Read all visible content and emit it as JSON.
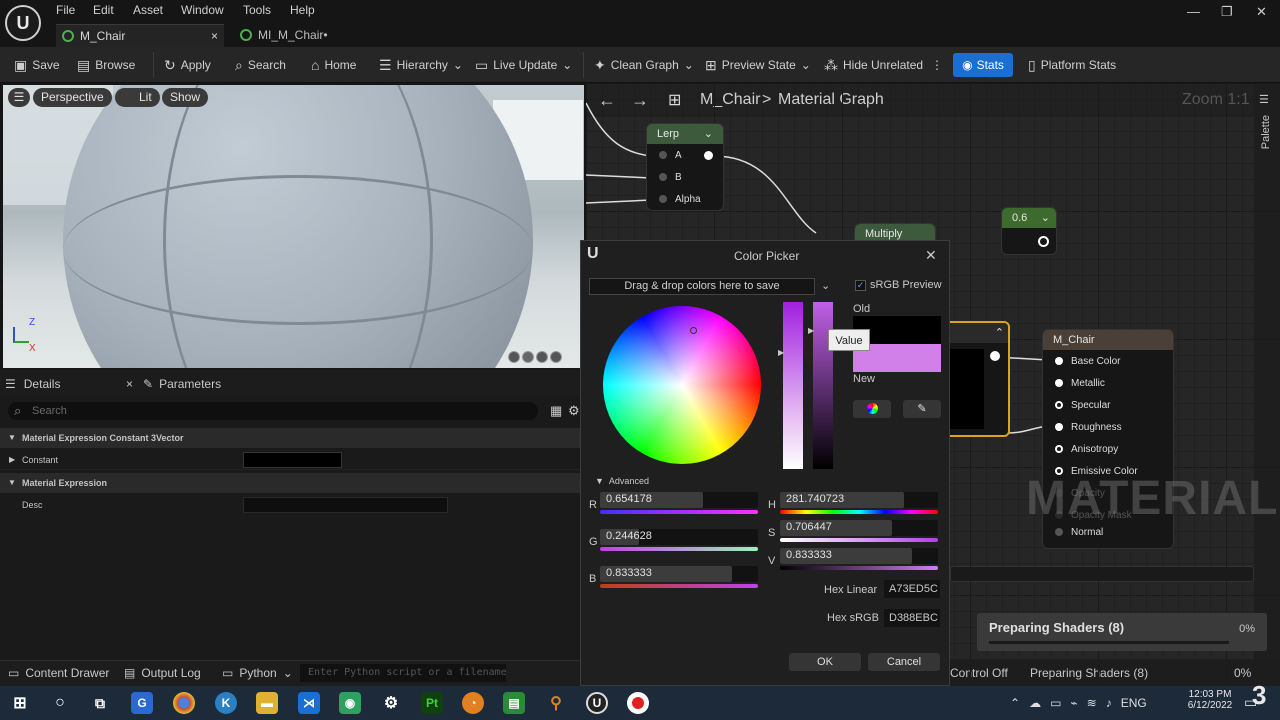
{
  "app": {
    "logo": "U",
    "menu": [
      "File",
      "Edit",
      "Asset",
      "Window",
      "Tools",
      "Help"
    ]
  },
  "tabs": [
    {
      "label": "M_Chair",
      "close": "×"
    },
    {
      "label": "MI_M_Chair•"
    }
  ],
  "toolbar": {
    "save": "Save",
    "browse": "Browse",
    "apply": "Apply",
    "search": "Search",
    "home": "Home",
    "hierarchy": "Hierarchy",
    "live_update": "Live Update",
    "clean_graph": "Clean Graph",
    "preview_state": "Preview State",
    "hide_unrelated": "Hide Unrelated",
    "stats": "Stats",
    "platform_stats": "Platform Stats"
  },
  "viewport": {
    "perspective": "Perspective",
    "lit": "Lit",
    "show": "Show",
    "axis_z": "Z",
    "axis_x": "X"
  },
  "details": {
    "tab_details": "Details",
    "tab_parameters": "Parameters",
    "search_placeholder": "Search",
    "section1": "Material Expression Constant 3Vector",
    "constant_label": "Constant",
    "section2": "Material Expression",
    "desc_label": "Desc"
  },
  "bottom": {
    "content_drawer": "Content Drawer",
    "output_log": "Output Log",
    "python": "Python",
    "cmd_placeholder": "Enter Python script or a filename"
  },
  "graph": {
    "breadcrumb_root": "M_Chair",
    "breadcrumb_sep": ">",
    "breadcrumb_page": "Material Graph",
    "zoom": "Zoom 1:1",
    "palette": "Palette",
    "watermark": "MATERIAL",
    "lerp": {
      "title": "Lerp",
      "pins": [
        "A",
        "B",
        "Alpha"
      ]
    },
    "multiply": "Multiply",
    "const": "0.6",
    "mchair": {
      "title": "M_Chair",
      "pins": [
        "Base Color",
        "Metallic",
        "Specular",
        "Roughness",
        "Anisotropy",
        "Emissive Color",
        "Opacity",
        "Opacity Mask",
        "Normal"
      ]
    },
    "control_off": "Control Off",
    "preparing": "Preparing Shaders (8)",
    "preparing_pct": "0%"
  },
  "picker": {
    "title": "Color Picker",
    "drag_drop": "Drag & drop colors here to save",
    "srgb": "sRGB Preview",
    "old": "Old",
    "new": "New",
    "tooltip": "Value",
    "advanced": "Advanced",
    "R": "0.654178",
    "G": "0.244628",
    "B": "0.833333",
    "H": "281.740723",
    "S": "0.706447",
    "V": "0.833333",
    "r_frac": 0.654,
    "g_frac": 0.245,
    "b_frac": 0.833,
    "h_frac": 0.783,
    "s_frac": 0.706,
    "v_frac": 0.833,
    "hex_linear_label": "Hex Linear",
    "hex_linear": "A73ED5C",
    "hex_srgb_label": "Hex sRGB",
    "hex_srgb": "D388EBC",
    "ok": "OK",
    "cancel": "Cancel",
    "new_color": "#d080e8",
    "old_color": "#000000"
  },
  "taskbar": {
    "lang": "ENG",
    "time": "12:03 PM",
    "date": "6/12/2022"
  },
  "corner_badge": "3"
}
